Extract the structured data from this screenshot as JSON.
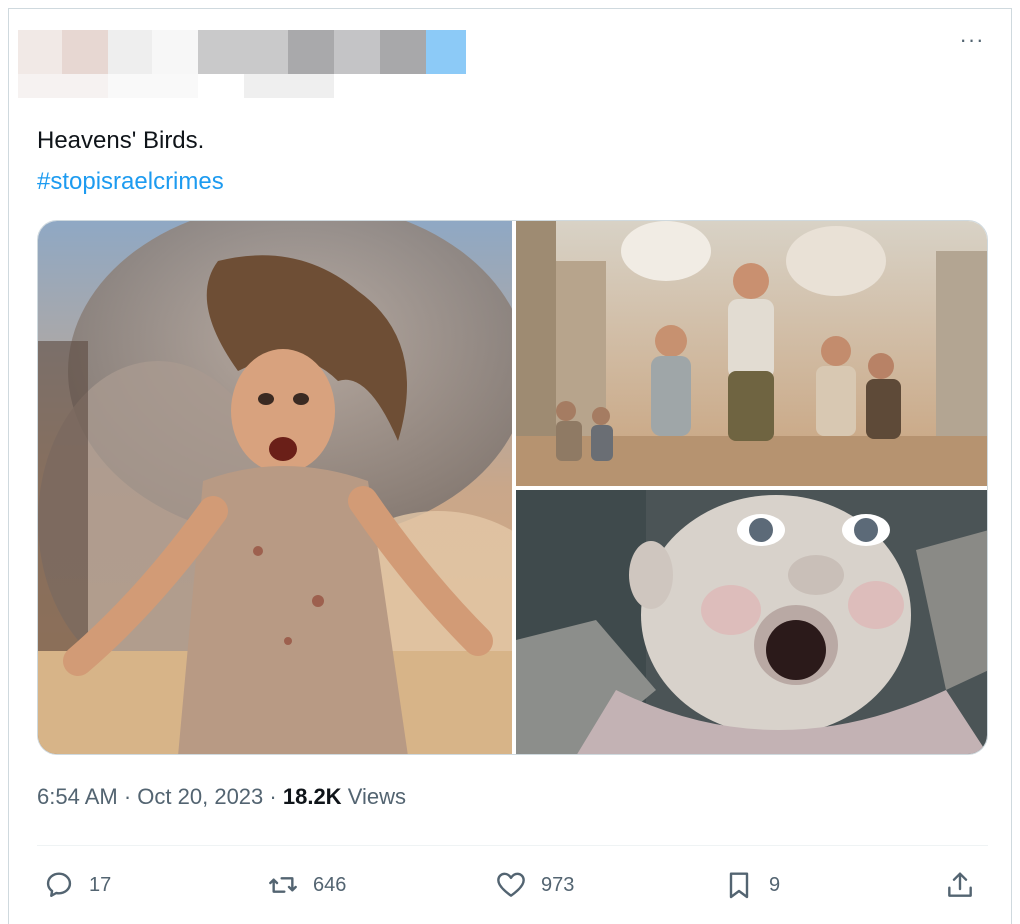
{
  "post": {
    "text": "Heavens' Birds.",
    "hashtag": "#stopisraelcrimes",
    "time": "6:54 AM",
    "date": "Oct 20, 2023",
    "views_count": "18.2K",
    "views_label": "Views",
    "more_label": "···"
  },
  "actions": {
    "replies": "17",
    "reposts": "646",
    "likes": "973",
    "bookmarks": "9"
  },
  "media": [
    {
      "icon": "image-girl-running-smoke"
    },
    {
      "icon": "image-children-running-street"
    },
    {
      "icon": "image-baby-crying-rubble"
    }
  ],
  "colors": {
    "hashtag": "#1d9bf0",
    "secondary_text": "#536471",
    "border": "#cfd9de"
  }
}
